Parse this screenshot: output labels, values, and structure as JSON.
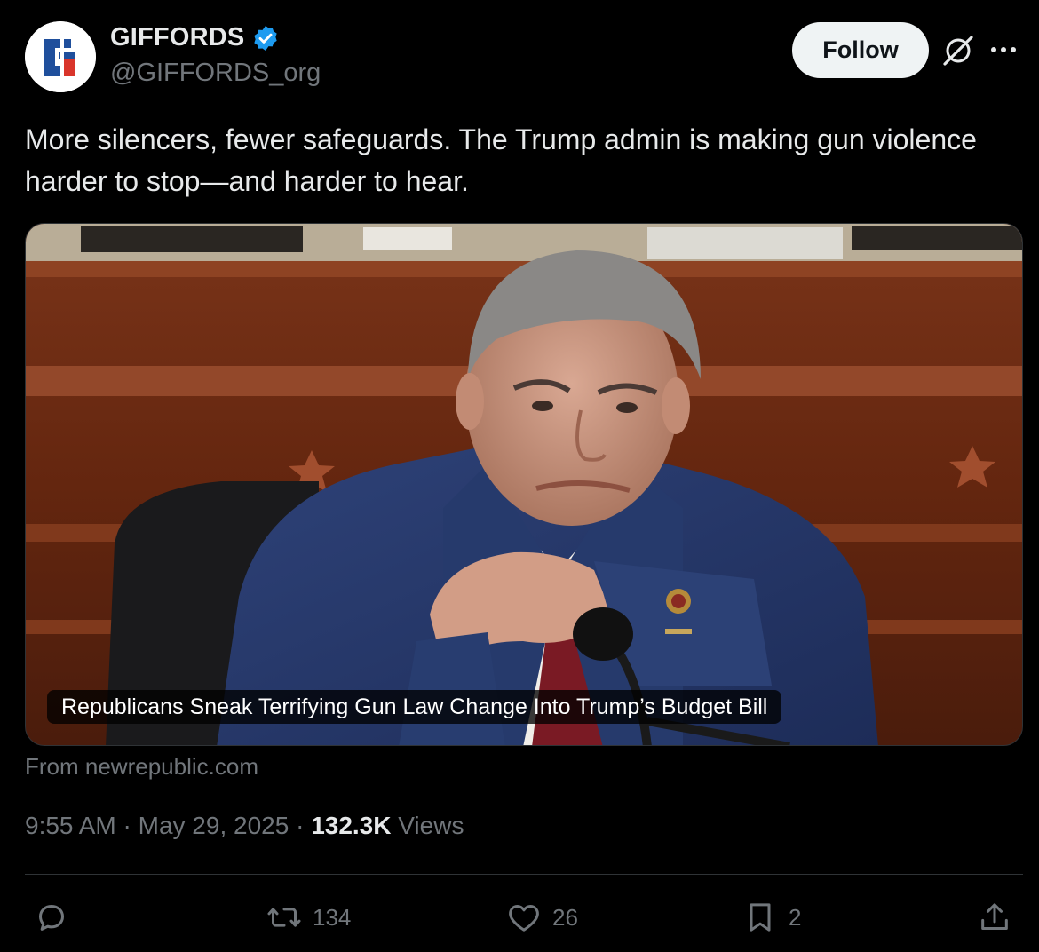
{
  "author": {
    "display_name": "GIFFORDS",
    "handle": "@GIFFORDS_org",
    "verified": true,
    "avatar_letter": "G"
  },
  "follow_button": {
    "label": "Follow"
  },
  "icons": {
    "grok": "grok-icon",
    "more": "more-options-icon"
  },
  "tweet": {
    "text": "More silencers, fewer safeguards. The Trump admin is making gun violence harder to stop—and harder to hear."
  },
  "link_card": {
    "headline": "Republicans Sneak Terrifying Gun Law Change Into Trump’s Budget Bill",
    "source": "From newrepublic.com"
  },
  "meta": {
    "time": "9:55 AM",
    "separator": "·",
    "date": "May 29, 2025",
    "views_count": "132.3K",
    "views_label": "Views"
  },
  "actions": {
    "reply": {
      "icon": "reply-icon",
      "count": ""
    },
    "repost": {
      "icon": "repost-icon",
      "count": "134"
    },
    "like": {
      "icon": "heart-icon",
      "count": "26"
    },
    "bookmark": {
      "icon": "bookmark-icon",
      "count": "2"
    },
    "share": {
      "icon": "share-icon",
      "count": ""
    }
  },
  "colors": {
    "background": "#000000",
    "text_primary": "#e7e9ea",
    "text_secondary": "#71767b",
    "verified_blue": "#1d9bf0",
    "divider": "#2f3336",
    "follow_bg": "#eff3f4"
  }
}
